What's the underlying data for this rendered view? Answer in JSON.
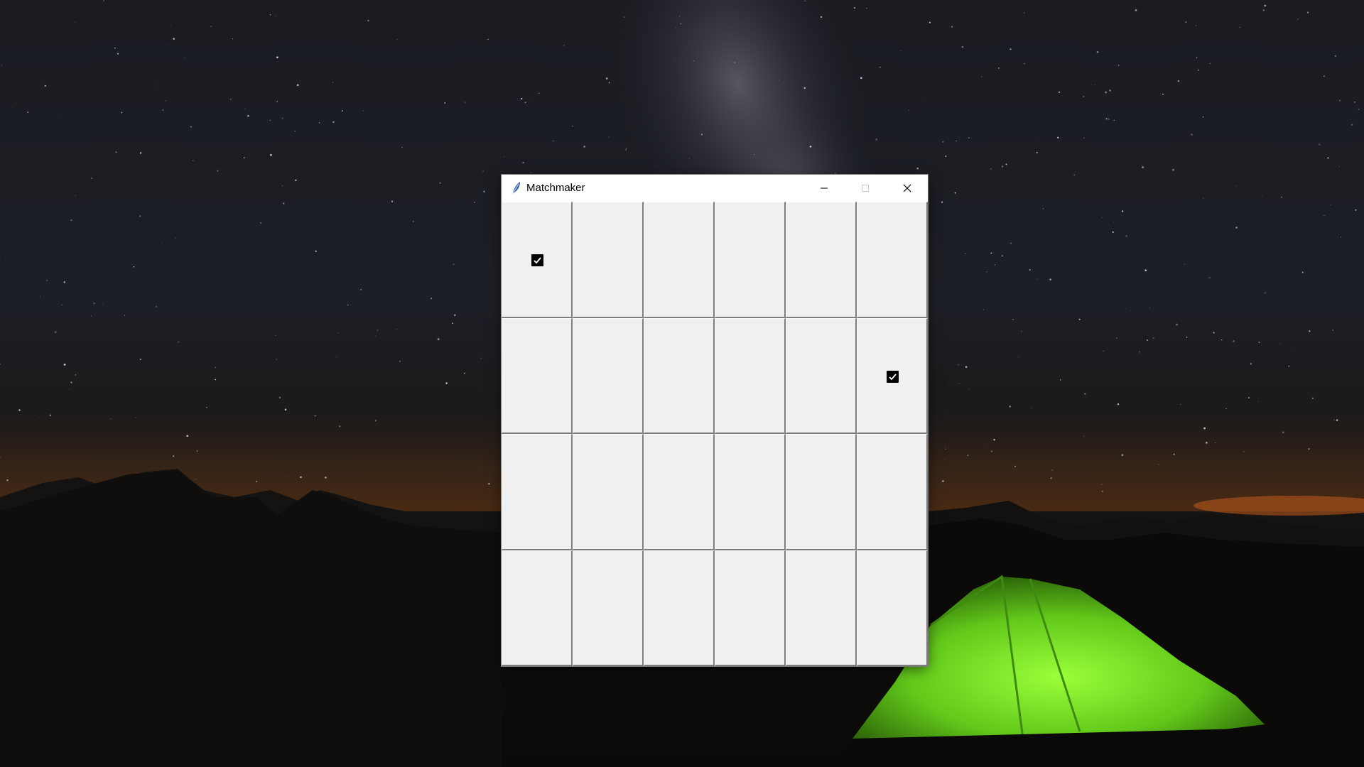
{
  "window": {
    "title": "Matchmaker",
    "app_icon": "feather-icon",
    "buttons": {
      "minimize": "minimize-icon",
      "maximize": "maximize-icon",
      "close": "close-icon"
    }
  },
  "grid": {
    "rows": 4,
    "cols": 6,
    "checked": [
      {
        "row": 0,
        "col": 0
      },
      {
        "row": 1,
        "col": 5
      }
    ]
  },
  "colors": {
    "cell_face": "#f0f0f0",
    "cell_shadow": "#7d7d7d",
    "check_fill": "#000000"
  }
}
